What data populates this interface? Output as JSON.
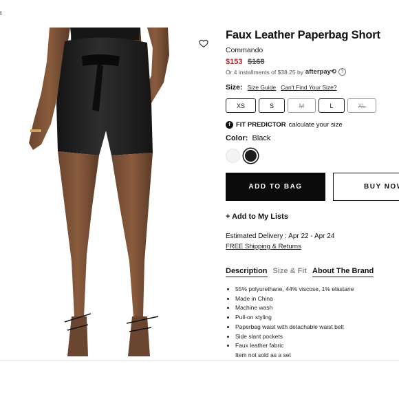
{
  "page": {
    "fragment_text": "t"
  },
  "product": {
    "title": "Faux Leather Paperbag Short",
    "brand": "Commando",
    "price_sale": "$153",
    "price_original": "$168",
    "installments_text": "Or 4 installments of $38.25 by",
    "afterpay_label": "afterpay",
    "help_icon_glyph": "?"
  },
  "size": {
    "label": "Size:",
    "guide_link": "Size Guide",
    "cant_find_link": "Can't Find Your Size?",
    "options": [
      {
        "label": "XS",
        "available": true
      },
      {
        "label": "S",
        "available": true
      },
      {
        "label": "M",
        "available": false
      },
      {
        "label": "L",
        "available": true
      },
      {
        "label": "XL",
        "available": false
      }
    ]
  },
  "fit": {
    "icon_glyph": "f",
    "title": "FIT PREDICTOR",
    "subtitle": "calculate your size"
  },
  "color": {
    "label": "Color:",
    "selected": "Black",
    "swatches": [
      {
        "name": "White",
        "hex": "#f4f4f4"
      },
      {
        "name": "Black",
        "hex": "#1c1c1c"
      }
    ]
  },
  "actions": {
    "add_to_bag": "ADD TO BAG",
    "buy_now": "BUY NOW",
    "add_to_lists": "+ Add to My Lists"
  },
  "delivery": {
    "estimated": "Estimated Delivery : Apr 22 - Apr 24",
    "shipping_link": "FREE Shipping & Returns"
  },
  "tabs": [
    {
      "label": "Description",
      "active": true
    },
    {
      "label": "Size & Fit",
      "active": false
    },
    {
      "label": "About The Brand",
      "active": false
    }
  ],
  "description": {
    "bullets": [
      "55% polyurethane, 44% viscose, 1% elastane",
      "Made in China",
      "Machine wash",
      "Pull-on styling",
      "Paperbag waist with detachable waist belt",
      "Side slant pockets",
      "Faux leather fabric"
    ],
    "last_line": "Item not sold as a set"
  },
  "icons": {
    "wishlist": "heart-icon",
    "fit_predictor": "fit-predictor-icon",
    "help": "question-icon"
  },
  "colors": {
    "sale_price": "#b3262d",
    "primary_button": "#0b0b0b",
    "text": "#111111"
  }
}
